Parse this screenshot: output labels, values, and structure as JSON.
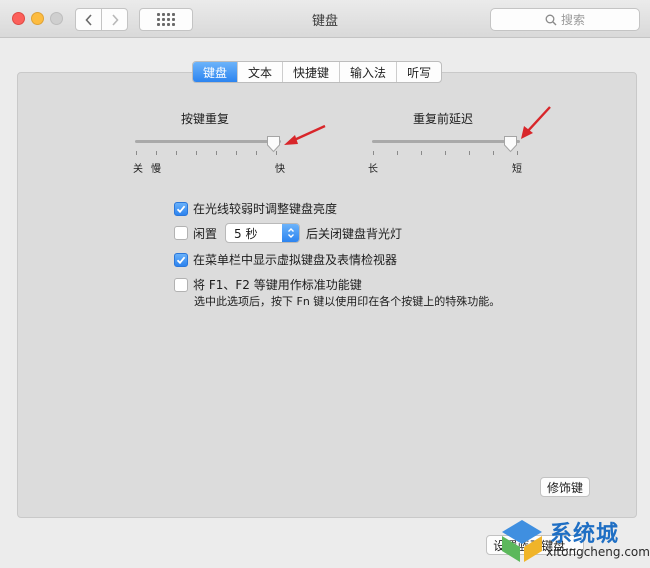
{
  "window": {
    "title": "键盘",
    "search_placeholder": "搜索"
  },
  "tabs": [
    {
      "label": "键盘",
      "active": true
    },
    {
      "label": "文本",
      "active": false
    },
    {
      "label": "快捷键",
      "active": false
    },
    {
      "label": "输入法",
      "active": false
    },
    {
      "label": "听写",
      "active": false
    }
  ],
  "key_repeat": {
    "title": "按键重复",
    "min_label_left": "关",
    "min_label_right": "慢",
    "max_label": "快",
    "level": 1.0
  },
  "delay_until_repeat": {
    "title": "重复前延迟",
    "min_label": "长",
    "max_label": "短",
    "level": 1.0
  },
  "options": {
    "adjust_brightness": {
      "label": "在光线较弱时调整键盘亮度",
      "checked": true
    },
    "backlight_off": {
      "prefix": "闲置",
      "value": "5 秒",
      "suffix": "后关闭键盘背光灯",
      "checked": false
    },
    "show_viewer": {
      "label": "在菜单栏中显示虚拟键盘及表情检视器",
      "checked": true
    },
    "fn_keys": {
      "label": "将 F1、F2 等键用作标准功能键",
      "checked": false,
      "note": "选中此选项后，按下 Fn 键以使用印在各个按键上的特殊功能。"
    }
  },
  "buttons": {
    "modifier": "修饰键",
    "bluetooth": "设置蓝牙键盘..."
  },
  "watermark": {
    "name": "系统城",
    "url": "xitongcheng.com"
  },
  "colors": {
    "accent": "#2c84f0",
    "arrow": "#d8262a"
  }
}
